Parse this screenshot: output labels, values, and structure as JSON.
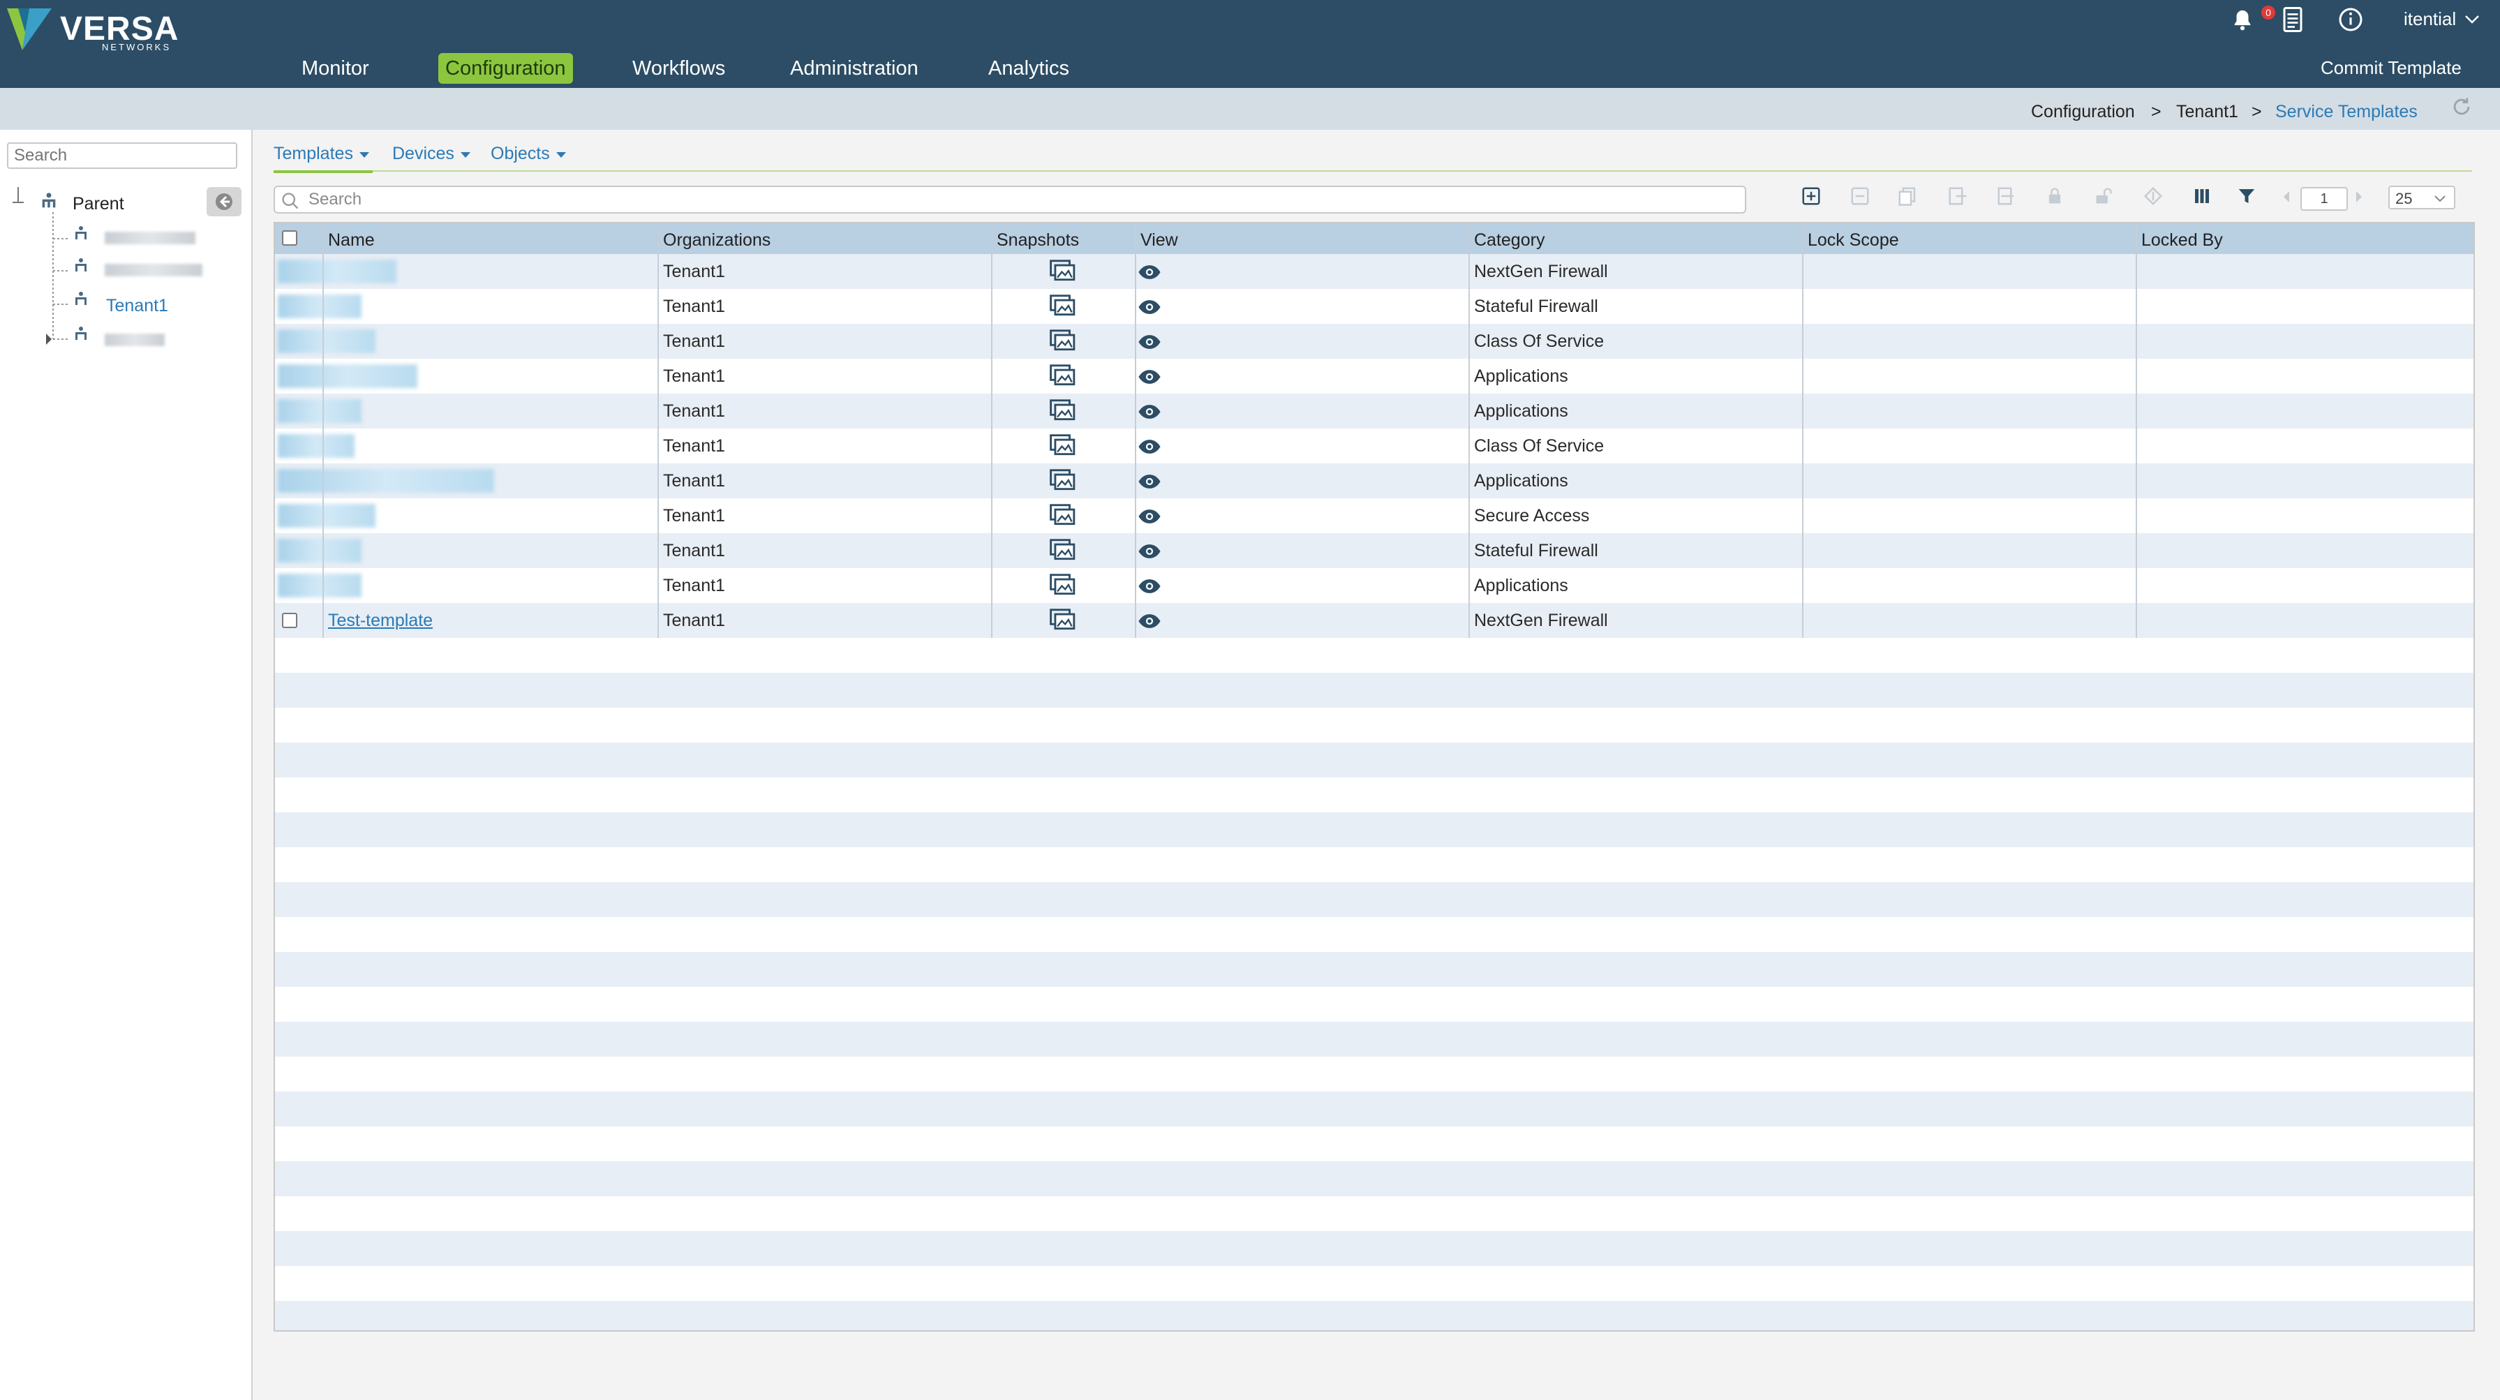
{
  "brand": {
    "name": "VERSA",
    "sub": "NETWORKS"
  },
  "nav": {
    "items": [
      {
        "label": "Monitor"
      },
      {
        "label": "Configuration"
      },
      {
        "label": "Workflows"
      },
      {
        "label": "Administration"
      },
      {
        "label": "Analytics"
      }
    ],
    "active": "Configuration"
  },
  "header": {
    "notification_count": "0",
    "user": "itential",
    "commit_label": "Commit Template"
  },
  "breadcrumb": {
    "items": [
      "Configuration",
      "Tenant1",
      "Service Templates"
    ],
    "separator": ">"
  },
  "left_panel": {
    "search_placeholder": "Search",
    "tree": {
      "root": "Parent",
      "selected": "Tenant1"
    }
  },
  "subtabs": [
    "Templates",
    "Devices",
    "Objects"
  ],
  "grid": {
    "search_placeholder": "Search",
    "page": "1",
    "page_size": "25",
    "columns": [
      "Name",
      "Organizations",
      "Snapshots",
      "View",
      "Category",
      "Lock Scope",
      "Locked By"
    ],
    "rows": [
      {
        "name": "",
        "org": "Tenant1",
        "category": "NextGen Firewall"
      },
      {
        "name": "",
        "org": "Tenant1",
        "category": "Stateful Firewall"
      },
      {
        "name": "",
        "org": "Tenant1",
        "category": "Class Of Service"
      },
      {
        "name": "",
        "org": "Tenant1",
        "category": "Applications"
      },
      {
        "name": "",
        "org": "Tenant1",
        "category": "Applications"
      },
      {
        "name": "",
        "org": "Tenant1",
        "category": "Class Of Service"
      },
      {
        "name": "",
        "org": "Tenant1",
        "category": "Applications"
      },
      {
        "name": "",
        "org": "Tenant1",
        "category": "Secure Access"
      },
      {
        "name": "",
        "org": "Tenant1",
        "category": "Stateful Firewall"
      },
      {
        "name": "",
        "org": "Tenant1",
        "category": "Applications"
      },
      {
        "name": "Test-template",
        "org": "Tenant1",
        "category": "NextGen Firewall"
      }
    ]
  },
  "icons": {
    "notifications": "bell-icon",
    "docs": "document-icon",
    "info": "info-icon",
    "refresh": "refresh-icon",
    "snapshot": "snapshot-icon",
    "view": "eye-icon"
  },
  "colors": {
    "topbar": "#2c4d65",
    "accent_green": "#8cc63f",
    "link_blue": "#2b7ab5",
    "grid_header": "#b9cfe2",
    "row_stripe": "#e8eef5"
  }
}
